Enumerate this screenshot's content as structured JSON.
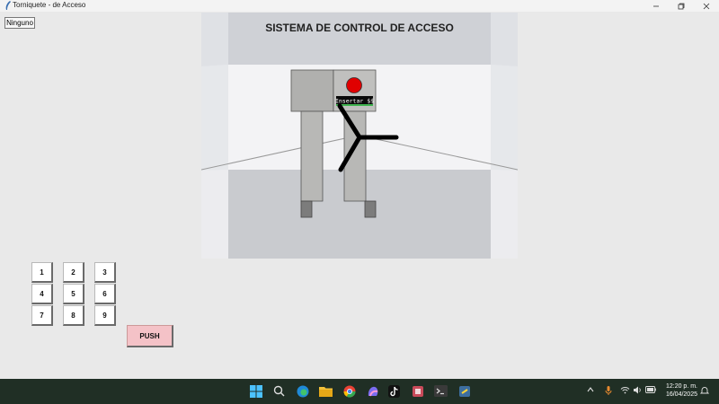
{
  "window": {
    "title": "Torniquete - de Acceso",
    "minimize_icon": "minimize-icon",
    "maximize_icon": "restore-icon",
    "close_icon": "close-icon"
  },
  "dropdown": {
    "label": "Ninguno"
  },
  "scene": {
    "heading": "SISTEMA DE CONTROL DE ACCESO",
    "screen_label": "Insertar $$",
    "indicator_color": "#e00000"
  },
  "keypad": {
    "keys": [
      "1",
      "2",
      "3",
      "4",
      "5",
      "6",
      "7",
      "8",
      "9"
    ],
    "push_label": "PUSH",
    "push_color": "#f4c2c7"
  },
  "taskbar": {
    "icons": [
      "windows-start-icon",
      "search-icon",
      "edge-browser-icon",
      "file-explorer-icon",
      "photos-icon",
      "chrome-icon",
      "copilot-icon",
      "tiktok-icon",
      "app-icon",
      "terminal-icon",
      "python-icon"
    ],
    "tray_icons": [
      "chevron-up-icon",
      "microphone-icon",
      "wifi-icon",
      "volume-icon",
      "battery-icon",
      "notification-icon"
    ],
    "time": "12:20 p. m.",
    "date": "16/04/2025"
  }
}
